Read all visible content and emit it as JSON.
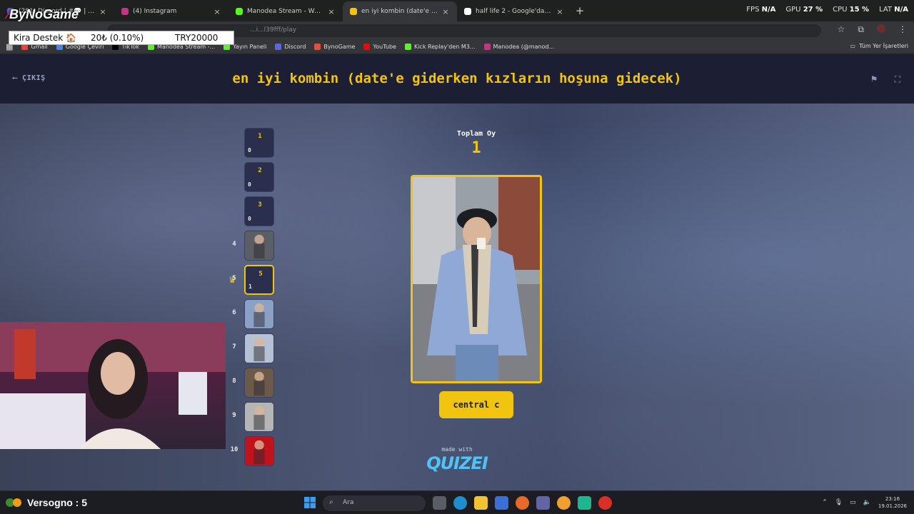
{
  "browser": {
    "tabs": [
      {
        "title": "(281) Discord | #💬 | genel-sohb",
        "active": false,
        "color": "#5865f2"
      },
      {
        "title": "(4) Instagram",
        "active": false,
        "color": "#c13584"
      },
      {
        "title": "Manodea Stream - Watch Live",
        "active": false,
        "color": "#53fc18"
      },
      {
        "title": "en iyi kombin (date'e giderken",
        "active": true,
        "color": "#f1c40f"
      },
      {
        "title": "half life 2 - Google'da Ara",
        "active": false,
        "color": "#ffffff"
      }
    ],
    "new_tab": "+",
    "sysmon": [
      {
        "label": "FPS",
        "value": "N/A"
      },
      {
        "label": "GPU",
        "value": "27 %"
      },
      {
        "label": "CPU",
        "value": "15 %"
      },
      {
        "label": "LAT",
        "value": "N/A"
      }
    ],
    "address": "...i...l39fff/play",
    "bookmarks": [
      {
        "label": "Gmail",
        "color": "#ea4335"
      },
      {
        "label": "Google Çeviri",
        "color": "#4285f4"
      },
      {
        "label": "TikTok",
        "color": "#000000"
      },
      {
        "label": "Manodea Stream -...",
        "color": "#53fc18"
      },
      {
        "label": "Yayın Paneli",
        "color": "#53fc18"
      },
      {
        "label": "Discord",
        "color": "#5865f2"
      },
      {
        "label": "BynoGame",
        "color": "#e74c3c"
      },
      {
        "label": "YouTube",
        "color": "#ff0000"
      },
      {
        "label": "Kick Replay'den M3...",
        "color": "#53fc18"
      },
      {
        "label": "Manodea (@manod...",
        "color": "#c13584"
      }
    ],
    "all_bookmarks": "Tüm Yer İşaretleri"
  },
  "overlay": {
    "logo": "ByNoGame",
    "kira_label": "Kira Destek 🏠",
    "kira_amount": "20₺ (0.10%)",
    "kira_goal": "TRY20000"
  },
  "page": {
    "back_label": "ÇIKIŞ",
    "title": "en iyi kombin (date'e giderken kızların hoşuna gidecek)",
    "total_label": "Toplam Oy",
    "total_value": "1",
    "choice_label": "central c",
    "made_with": "made with",
    "brand": "QUIZEI",
    "rounds": [
      {
        "num": "1",
        "inner": "1",
        "count": "0",
        "type": "text"
      },
      {
        "num": "2",
        "inner": "2",
        "count": "0",
        "type": "text"
      },
      {
        "num": "3",
        "inner": "3",
        "count": "0",
        "type": "text"
      },
      {
        "num": "4",
        "inner": "",
        "count": "",
        "type": "image",
        "color": "#5a5f66"
      },
      {
        "num": "5",
        "inner": "5",
        "count": "1",
        "type": "winner"
      },
      {
        "num": "6",
        "inner": "",
        "count": "",
        "type": "image",
        "color": "#8aa0c4"
      },
      {
        "num": "7",
        "inner": "",
        "count": "",
        "type": "image",
        "color": "#b6c2d4"
      },
      {
        "num": "8",
        "inner": "",
        "count": "",
        "type": "image",
        "color": "#6b5a4a"
      },
      {
        "num": "9",
        "inner": "",
        "count": "",
        "type": "image",
        "color": "#b5b5b5"
      },
      {
        "num": "10",
        "inner": "",
        "count": "",
        "type": "image",
        "color": "#c0131c"
      }
    ]
  },
  "taskbar": {
    "viewer_label": "Versogno : 5",
    "search_placeholder": "Ara",
    "time": "23:16",
    "date": "19.01.2026"
  }
}
